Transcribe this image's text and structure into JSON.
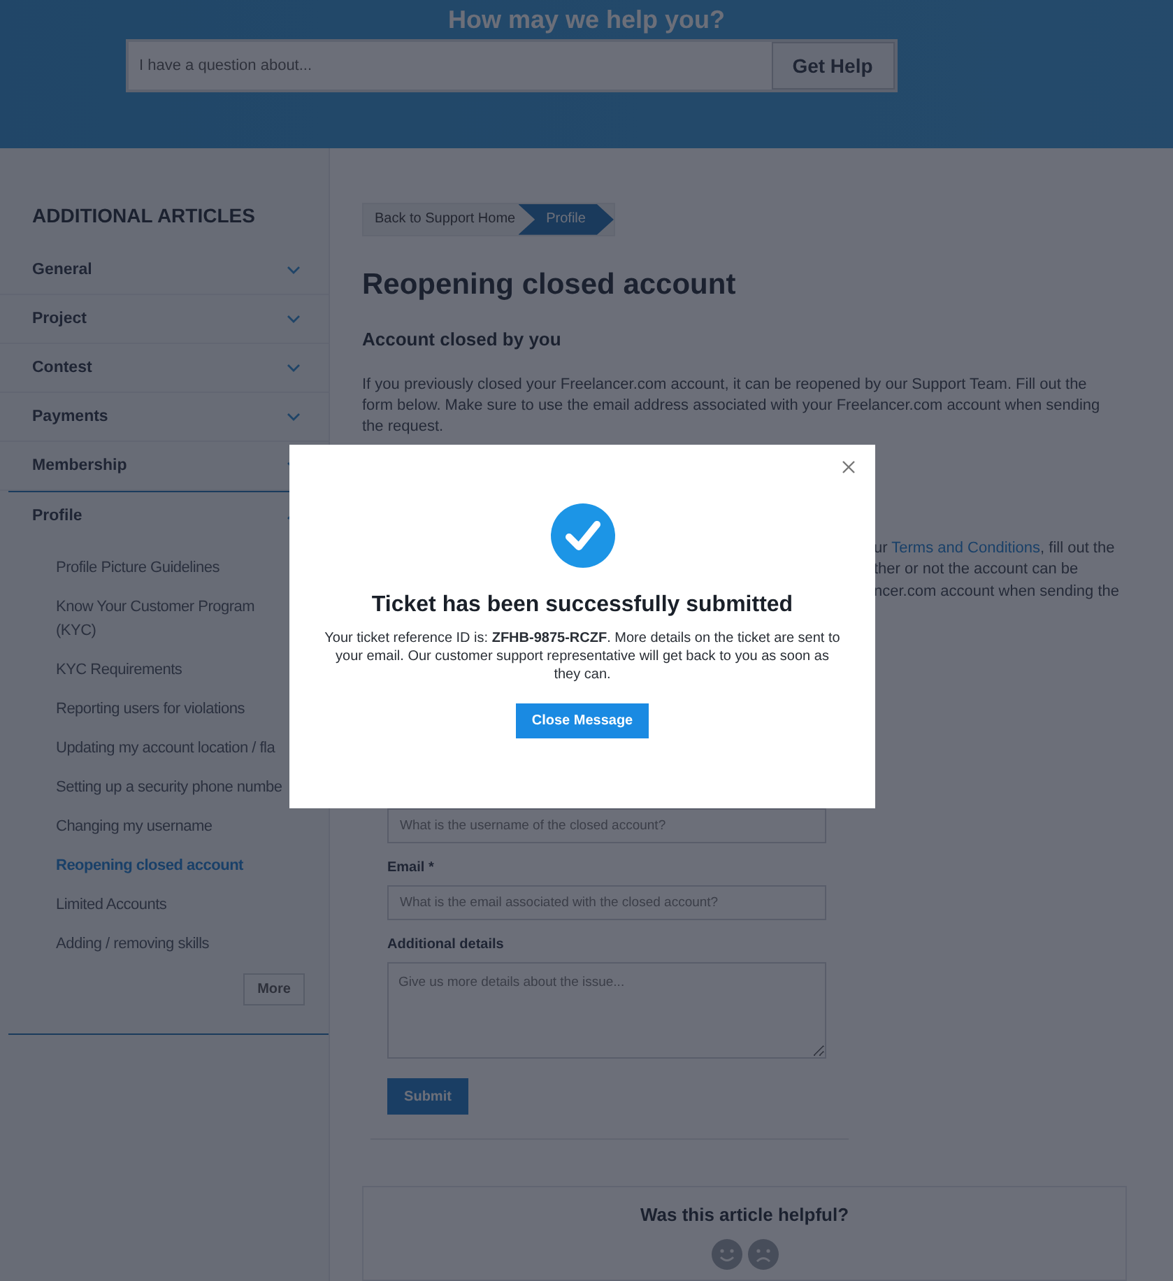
{
  "header": {
    "title": "How may we help you?",
    "search": {
      "placeholder": "I have a question about..."
    },
    "button": "Get Help"
  },
  "sidebar": {
    "heading": "ADDITIONAL ARTICLES",
    "categories": [
      {
        "label": "General",
        "expanded": false
      },
      {
        "label": "Project",
        "expanded": false
      },
      {
        "label": "Contest",
        "expanded": false
      },
      {
        "label": "Payments",
        "expanded": false
      },
      {
        "label": "Membership",
        "expanded": false
      },
      {
        "label": "Profile",
        "expanded": true,
        "children": [
          {
            "label": "Profile Picture Guidelines",
            "selected": false
          },
          {
            "label": "Know Your Customer Program\n(KYC)",
            "selected": false
          },
          {
            "label": "KYC Requirements",
            "selected": false
          },
          {
            "label": "Reporting users for violations",
            "selected": false
          },
          {
            "label": "Updating my account location / fla",
            "selected": false
          },
          {
            "label": "Setting up a security phone numbe",
            "selected": false
          },
          {
            "label": "Changing my username",
            "selected": false
          },
          {
            "label": "Reopening closed account",
            "selected": true
          },
          {
            "label": "Limited Accounts",
            "selected": false
          },
          {
            "label": "Adding / removing skills",
            "selected": false
          }
        ]
      }
    ],
    "more_button": "More"
  },
  "breadcrumb": [
    {
      "label": "Back to Support Home",
      "selected": false
    },
    {
      "label": "Profile",
      "selected": true
    }
  ],
  "article": {
    "title": "Reopening closed account",
    "subtitle": "Account closed by you",
    "paragraph": "If you previously closed your Freelancer.com account, it can be reopened by our Support Team. Fill out the form below. Make sure to use the email address associated with your Freelancer.com account when sending the request.",
    "partial_lines": [
      {
        "parts": [
          {
            "kind": "text",
            "text": "ur "
          },
          {
            "kind": "link",
            "text": "Terms and Conditions"
          },
          {
            "kind": "text",
            "text": ", fill out the"
          }
        ]
      },
      {
        "parts": [
          {
            "kind": "text",
            "text": "ther or not the account can be"
          }
        ]
      },
      {
        "parts": [
          {
            "kind": "text",
            "text": "ncer.com account when sending the"
          }
        ]
      }
    ]
  },
  "form": {
    "fields": [
      {
        "kind": "input",
        "placeholder": "What is the username of the closed account?"
      },
      {
        "kind": "input",
        "label": "Email *",
        "placeholder": "What is the email associated with the closed account?"
      },
      {
        "kind": "textarea",
        "label": "Additional details",
        "placeholder": "Give us more details about the issue..."
      }
    ],
    "submit": "Submit"
  },
  "feedback": {
    "question": "Was this article helpful?"
  },
  "modal": {
    "title": "Ticket has been successfully submitted",
    "message": "Your ticket reference ID is: **ZFHB-9875-RCZF**. More details on the ticket are sent to your email. Our customer support representative will get back to you as soon as they can.",
    "button": "Close Message"
  }
}
